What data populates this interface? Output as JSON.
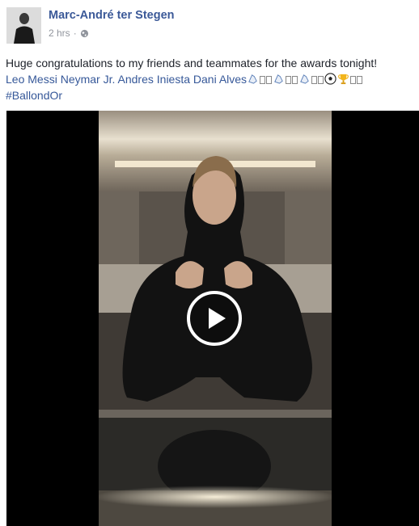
{
  "post": {
    "author": "Marc-André ter Stegen",
    "timestamp": "2 hrs",
    "separator": "·",
    "privacy_icon": "globe-icon",
    "text": "Huge congratulations to my friends and teammates for the awards tonight!",
    "tags": [
      "Leo Messi",
      "Neymar Jr.",
      "Andres Iniesta",
      "Dani Alves"
    ],
    "hashtag": "#BallondOr"
  },
  "video": {
    "play_icon": "play-icon"
  },
  "colors": {
    "link": "#365899",
    "author": "#3b5998",
    "meta": "#90949c",
    "text": "#1d2129"
  }
}
